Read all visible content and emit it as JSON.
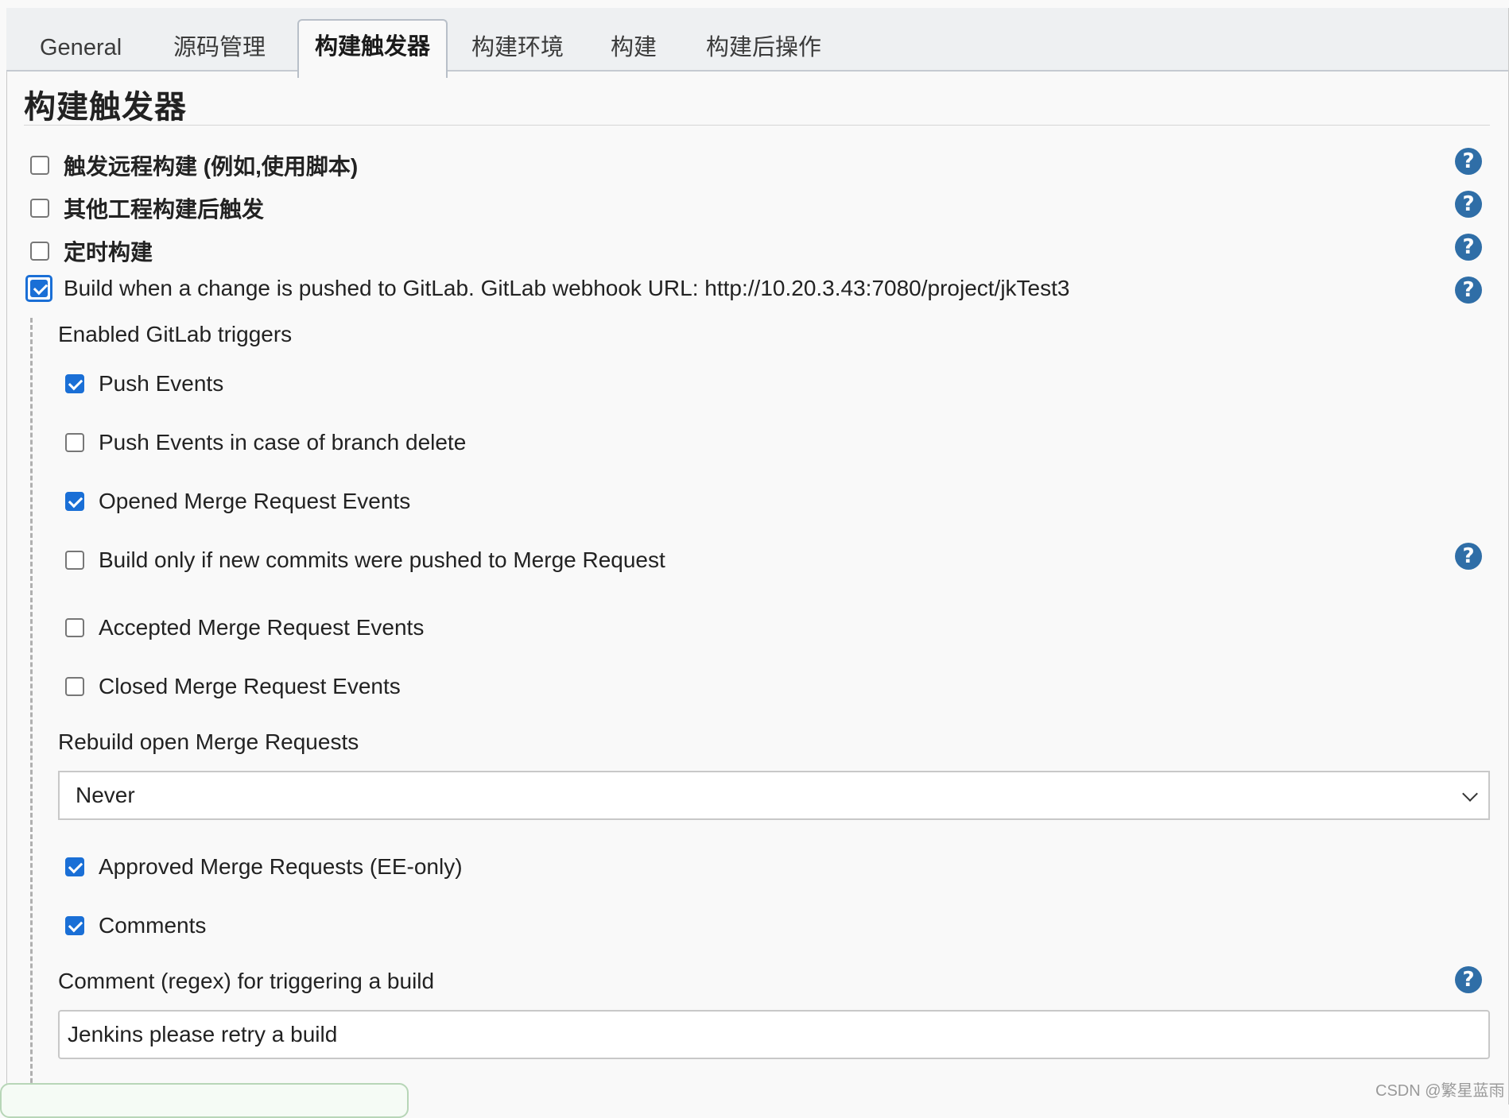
{
  "tabs": [
    {
      "label": "General",
      "active": false
    },
    {
      "label": "源码管理",
      "active": false
    },
    {
      "label": "构建触发器",
      "active": true
    },
    {
      "label": "构建环境",
      "active": false
    },
    {
      "label": "构建",
      "active": false
    },
    {
      "label": "构建后操作",
      "active": false
    }
  ],
  "section": {
    "title": "构建触发器"
  },
  "triggers": [
    {
      "label": "触发远程构建 (例如,使用脚本)",
      "checked": false
    },
    {
      "label": "其他工程构建后触发",
      "checked": false
    },
    {
      "label": "定时构建",
      "checked": false
    },
    {
      "label": "Build when a change is pushed to GitLab. GitLab webhook URL: http://10.20.3.43:7080/project/jkTest3",
      "checked": true
    }
  ],
  "gitlab": {
    "enabled_triggers_label": "Enabled GitLab triggers",
    "options": [
      {
        "label": "Push Events",
        "checked": true
      },
      {
        "label": "Push Events in case of branch delete",
        "checked": false
      },
      {
        "label": "Opened Merge Request Events",
        "checked": true
      },
      {
        "label": "Build only if new commits were pushed to Merge Request",
        "checked": false
      },
      {
        "label": "Accepted Merge Request Events",
        "checked": false
      },
      {
        "label": "Closed Merge Request Events",
        "checked": false
      }
    ],
    "rebuild_label": "Rebuild open Merge Requests",
    "rebuild_value": "Never",
    "options2": [
      {
        "label": "Approved Merge Requests (EE-only)",
        "checked": true
      },
      {
        "label": "Comments",
        "checked": true
      }
    ],
    "comment_regex_label": "Comment (regex) for triggering a build",
    "comment_regex_value": "Jenkins please retry a build"
  },
  "help_icon_glyph": "?",
  "watermark": "CSDN @繁星蓝雨",
  "colors": {
    "accent": "#1a6fd6",
    "help": "#2f6ea7"
  }
}
